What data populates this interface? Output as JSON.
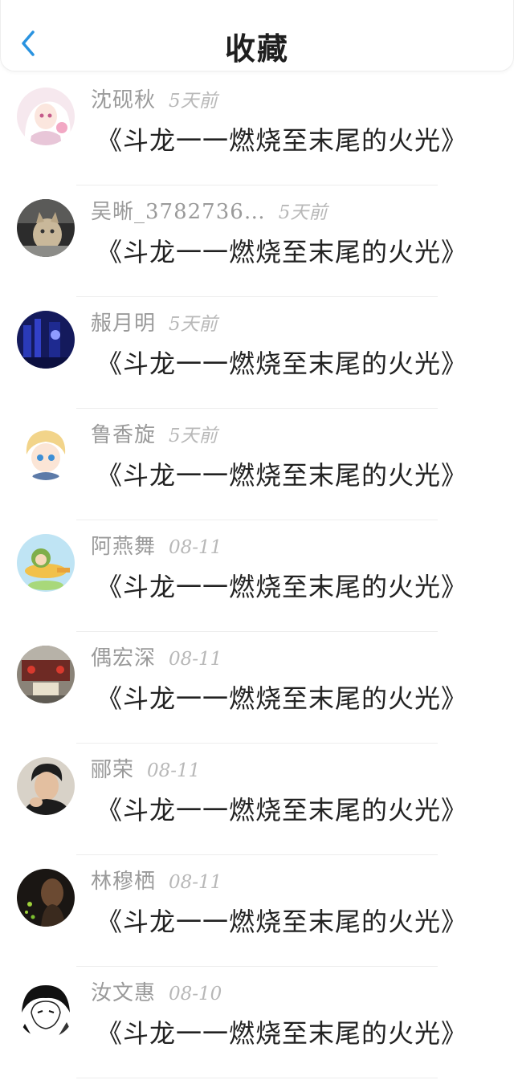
{
  "header": {
    "title": "收藏",
    "back_icon": "chevron-left-icon",
    "accent": "#2a93e0"
  },
  "items": [
    {
      "name": "沈砚秋",
      "time": "5天前",
      "content": "《斗龙一一燃烧至末尾的火光》",
      "avatar": "anime-girl-white-hair"
    },
    {
      "name": "吴晰_3782736…",
      "time": "5天前",
      "content": "《斗龙一一燃烧至末尾的火光》",
      "avatar": "cat-photo"
    },
    {
      "name": "赧月明",
      "time": "5天前",
      "content": "《斗龙一一燃烧至末尾的火光》",
      "avatar": "blue-night-scene"
    },
    {
      "name": "鲁香旋",
      "time": "5天前",
      "content": "《斗龙一一燃烧至末尾的火光》",
      "avatar": "anime-blonde-boy"
    },
    {
      "name": "阿燕舞",
      "time": "08-11",
      "content": "《斗龙一一燃烧至末尾的火光》",
      "avatar": "cartoon-pilot-plane"
    },
    {
      "name": "偶宏深",
      "time": "08-11",
      "content": "《斗龙一一燃烧至末尾的火光》",
      "avatar": "building-gate"
    },
    {
      "name": "郦荣",
      "time": "08-11",
      "content": "《斗龙一一燃烧至末尾的火光》",
      "avatar": "man-portrait"
    },
    {
      "name": "林穆栖",
      "time": "08-11",
      "content": "《斗龙一一燃烧至末尾的火光》",
      "avatar": "dark-silhouette"
    },
    {
      "name": "汝文惠",
      "time": "08-10",
      "content": "《斗龙一一燃烧至末尾的火光》",
      "avatar": "manga-sketch"
    }
  ]
}
